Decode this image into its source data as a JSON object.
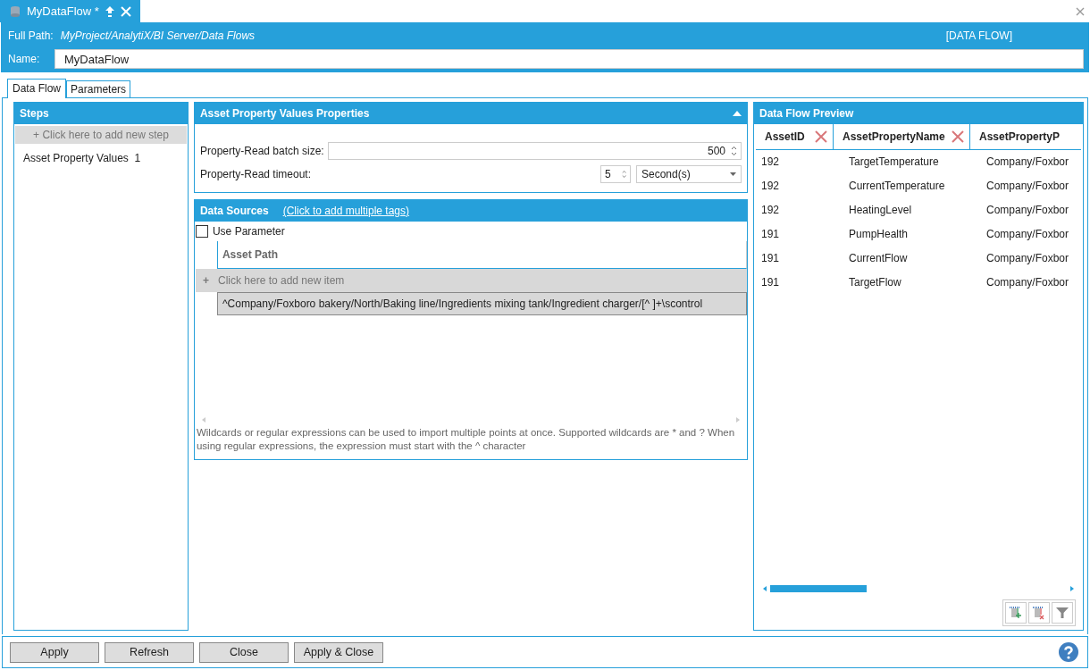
{
  "document_tab": {
    "title": "MyDataFlow *"
  },
  "header": {
    "path_label": "Full Path:",
    "path": "MyProject/AnalytiX/BI Server/Data Flows",
    "type_label": "[DATA FLOW]",
    "name_label": "Name:",
    "name_value": "MyDataFlow"
  },
  "tabs": [
    {
      "label": "Data Flow",
      "selected": true
    },
    {
      "label": "Parameters",
      "selected": false
    }
  ],
  "steps": {
    "title": "Steps",
    "add_hint": "+  Click here to add new step",
    "items": [
      {
        "label": "Asset Property Values",
        "count": "1",
        "selected": false
      }
    ]
  },
  "properties": {
    "title": "Asset Property Values Properties",
    "expanded": true,
    "batch_label": "Property-Read batch size:",
    "batch_value": "500",
    "timeout_label": "Property-Read timeout:",
    "timeout_value": "5",
    "timeout_unit": "Second(s)"
  },
  "data_sources": {
    "title": "Data Sources",
    "link": "(Click to add multiple tags)",
    "use_parameter": {
      "label": "Use Parameter",
      "checked": false
    },
    "column": "Asset Path",
    "add_hint": "Click here to add new item",
    "add_icon": "+",
    "rows": [
      "^Company/Foxboro bakery/North/Baking line/Ingredients mixing tank/Ingredient charger/[^ ]+\\scontrol"
    ],
    "note": "Wildcards or regular expressions can be used to import multiple points at once. Supported wildcards are * and ? When using regular expressions, the expression must start with the ^ character"
  },
  "preview": {
    "title": "Data Flow Preview",
    "columns": [
      {
        "label": "AssetID",
        "removable": true
      },
      {
        "label": "AssetPropertyName",
        "removable": true
      },
      {
        "label": "AssetPropertyP",
        "removable": false
      }
    ],
    "rows": [
      [
        "192",
        "TargetTemperature",
        "Company/Foxbor"
      ],
      [
        "192",
        "CurrentTemperature",
        "Company/Foxbor"
      ],
      [
        "192",
        "HeatingLevel",
        "Company/Foxbor"
      ],
      [
        "191",
        "PumpHealth",
        "Company/Foxbor"
      ],
      [
        "191",
        "CurrentFlow",
        "Company/Foxbor"
      ],
      [
        "191",
        "TargetFlow",
        "Company/Foxbor"
      ]
    ]
  },
  "buttons": [
    "Apply",
    "Refresh",
    "Close",
    "Apply & Close"
  ]
}
